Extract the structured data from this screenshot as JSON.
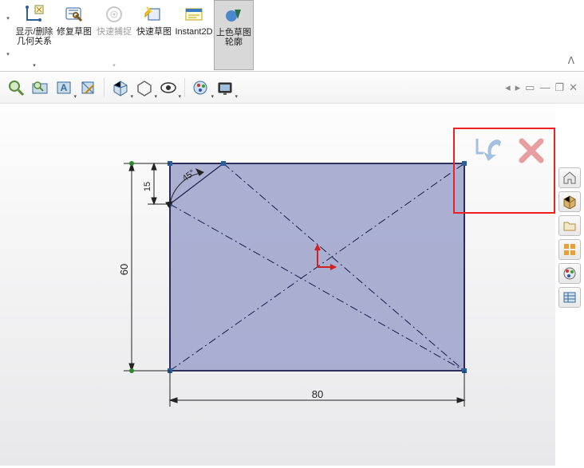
{
  "ribbon": {
    "btn_relations": "显示/删除几何关系",
    "btn_repair": "修复草图",
    "btn_quickcapture": "快速捕捉",
    "btn_quicksketch": "快速草图",
    "btn_instant2d": "Instant2D",
    "btn_shaded": "上色草图轮廓"
  },
  "dimensions": {
    "width": "80",
    "height": "60",
    "chamfer_len": "15",
    "chamfer_ang": "45°"
  },
  "side": {
    "home": "home-icon",
    "iso": "iso-view-icon",
    "open": "open-folder-icon",
    "palette": "palette-icon",
    "appearance": "appearance-icon",
    "options": "options-icon"
  }
}
